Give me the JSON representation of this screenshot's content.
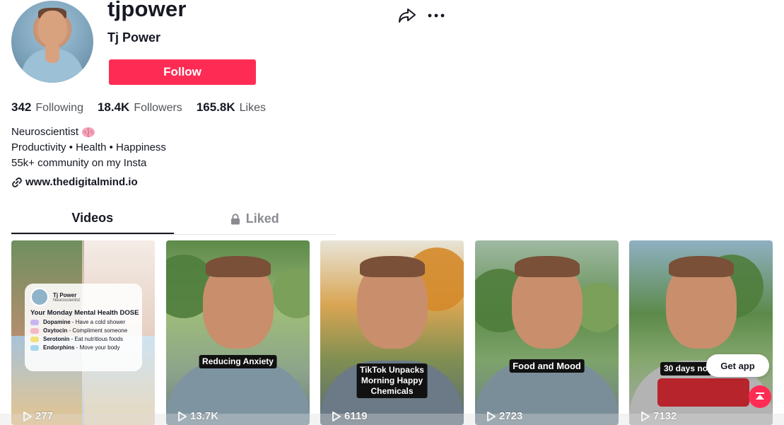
{
  "profile": {
    "username": "tjpower",
    "nickname": "Tj Power",
    "follow_label": "Follow",
    "stats": [
      {
        "value": "342",
        "label": "Following"
      },
      {
        "value": "18.4K",
        "label": "Followers"
      },
      {
        "value": "165.8K",
        "label": "Likes"
      }
    ],
    "bio": [
      "Neuroscientist",
      "Productivity • Health • Happiness",
      "55k+ community on my Insta"
    ],
    "link": "www.thedigitalmind.io"
  },
  "tabs": [
    {
      "label": "Videos",
      "active": true
    },
    {
      "label": "Liked",
      "active": false,
      "locked": true
    }
  ],
  "videos": [
    {
      "views": "277",
      "panel": {
        "name": "Tj Power",
        "role": "Neuroscientist",
        "title": "Your Monday Mental Health DOSE",
        "items": [
          {
            "chem": "Dopamine",
            "text": "Have a cold shower",
            "color": "#c8b6f0"
          },
          {
            "chem": "Oxytocin",
            "text": "Compliment someone",
            "color": "#f3b9c7"
          },
          {
            "chem": "Serotonin",
            "text": "Eat nutritious foods",
            "color": "#f4e07a"
          },
          {
            "chem": "Endorphins",
            "text": "Move your body",
            "color": "#a7d7f0"
          }
        ]
      }
    },
    {
      "views": "13.7K",
      "caption": "Reducing Anxiety"
    },
    {
      "views": "6119",
      "caption": "TikTok Unpacks\nMorning Happy\nChemicals"
    },
    {
      "views": "2723",
      "caption": "Food and Mood"
    },
    {
      "views": "7132",
      "caption": "30 days no"
    }
  ],
  "floating": {
    "get_app": "Get app"
  },
  "colors": {
    "accent": "#fe2c55",
    "text": "#161823",
    "muted": "#8a8b91"
  }
}
